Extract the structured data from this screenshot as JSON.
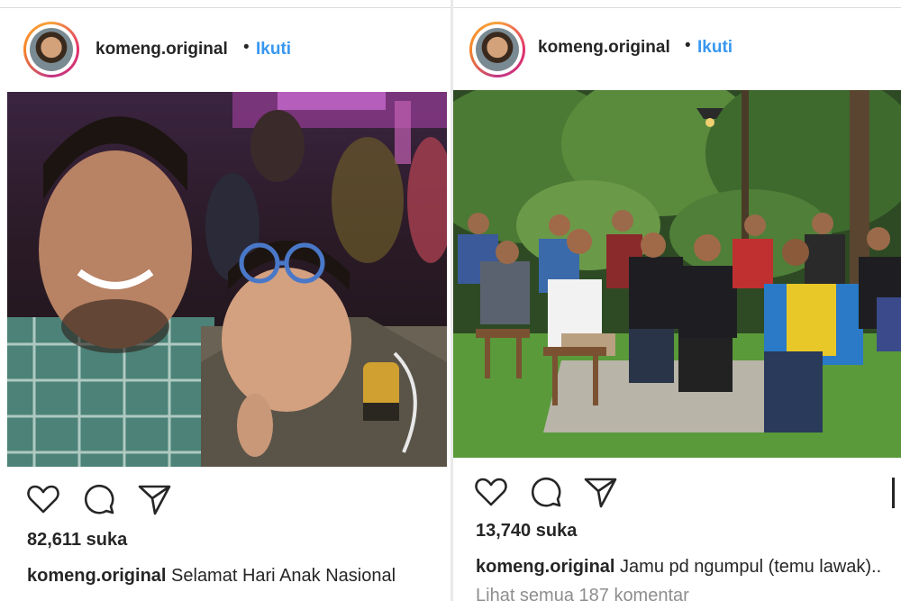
{
  "colors": {
    "accent": "#3897f0",
    "text": "#262626",
    "muted": "#8e8e8e"
  },
  "posts": [
    {
      "username": "komeng.original",
      "dot": "•",
      "follow_label": "Ikuti",
      "likes": "82,611 suka",
      "caption_user": "komeng.original",
      "caption_text": "Selamat Hari Anak Nasional",
      "icons": [
        "heart-icon",
        "comment-icon",
        "share-icon"
      ]
    },
    {
      "username": "komeng.original",
      "dot": "•",
      "follow_label": "Ikuti",
      "likes": "13,740 suka",
      "caption_user": "komeng.original",
      "caption_text": "Jamu pd ngumpul (temu lawak)..",
      "comments_text": "Lihat semua 187 komentar",
      "icons": [
        "heart-icon",
        "comment-icon",
        "share-icon"
      ]
    }
  ]
}
